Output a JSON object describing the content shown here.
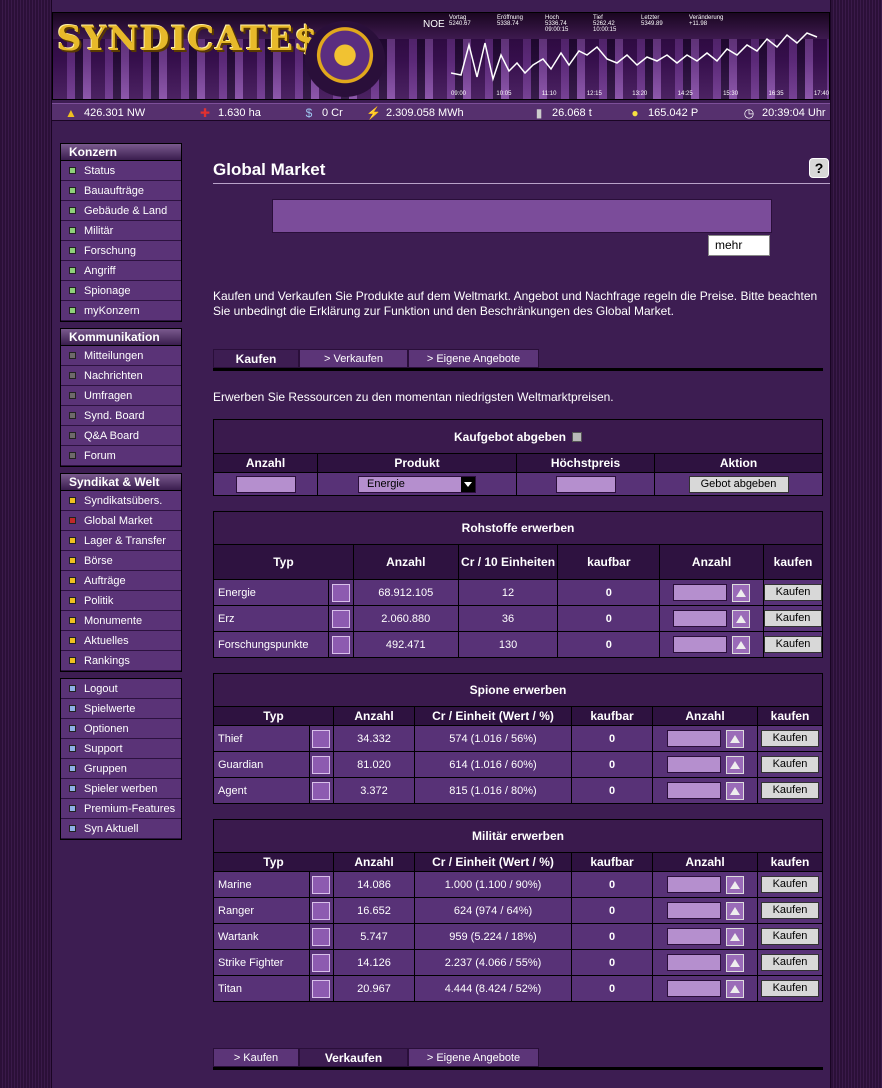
{
  "banner": {
    "logo": "SYNDICATE$",
    "noe": "NOE",
    "ticker": {
      "headers": [
        "Vortag",
        "Eröffnung",
        "Hoch",
        "Tief",
        "Letzter",
        "Veränderung"
      ],
      "row1": [
        "5240.67",
        "5338.74",
        "5336.74",
        "5262.42",
        "5349.89",
        "+11.98"
      ],
      "row2": [
        "",
        "",
        "09:00:15",
        "10:00:15",
        "",
        ""
      ]
    },
    "times": [
      "09:00",
      "10:05",
      "11:10",
      "12:15",
      "13:20",
      "14:25",
      "15:30",
      "16:35",
      "17:40"
    ]
  },
  "status": {
    "nw": "426.301 NW",
    "land": "1.630 ha",
    "credits": "0 Cr",
    "energy": "2.309.058 MWh",
    "ore": "26.068 t",
    "research": "165.042 P",
    "time": "20:39:04 Uhr"
  },
  "nav": {
    "konzern": {
      "title": "Konzern",
      "items": [
        "Status",
        "Bauaufträge",
        "Gebäude & Land",
        "Militär",
        "Forschung",
        "Angriff",
        "Spionage",
        "myKonzern"
      ]
    },
    "kommunikation": {
      "title": "Kommunikation",
      "items": [
        "Mitteilungen",
        "Nachrichten",
        "Umfragen",
        "Synd. Board",
        "Q&A Board",
        "Forum"
      ]
    },
    "syndikat": {
      "title": "Syndikat & Welt",
      "items": [
        "Syndikatsübers.",
        "Global Market",
        "Lager & Transfer",
        "Börse",
        "Aufträge",
        "Politik",
        "Monumente",
        "Aktuelles",
        "Rankings"
      ]
    },
    "misc": {
      "items": [
        "Logout",
        "Spielwerte",
        "Optionen",
        "Support",
        "Gruppen",
        "Spieler werben",
        "Premium-Features",
        "Syn Aktuell"
      ]
    }
  },
  "colors": {
    "konzern": "#8fd07a",
    "kommunikation": "#6e6a6a",
    "syndikat": "#f0c020",
    "syndikat_active": "#c22a2a",
    "misc": "#8fb0e6"
  },
  "page": {
    "title": "Global Market",
    "help": "?",
    "mehr": "mehr",
    "description": "Kaufen und Verkaufen Sie Produkte auf dem Weltmarkt. Angebot und Nachfrage regeln die Preise. Bitte beachten Sie unbedingt die Erklärung zur Funktion und den Beschränkungen des Global Market.",
    "tabs_top": [
      "Kaufen",
      "> Verkaufen",
      "> Eigene Angebote"
    ],
    "tabs_bottom": [
      "> Kaufen",
      "Verkaufen",
      "> Eigene Angebote"
    ],
    "intro": "Erwerben Sie Ressourcen zu den momentan niedrigsten Weltmarktpreisen."
  },
  "bid": {
    "caption": "Kaufgebot abgeben",
    "headers": [
      "Anzahl",
      "Produkt",
      "Höchstpreis",
      "Aktion"
    ],
    "product": "Energie",
    "button": "Gebot abgeben"
  },
  "resources": {
    "caption": "Rohstoffe erwerben",
    "headers": [
      "Typ",
      "Anzahl",
      "Cr / 10 Einheiten",
      "kaufbar",
      "Anzahl",
      "kaufen"
    ],
    "rows": [
      {
        "typ": "Energie",
        "anzahl": "68.912.105",
        "preis": "12",
        "kaufbar": "0"
      },
      {
        "typ": "Erz",
        "anzahl": "2.060.880",
        "preis": "36",
        "kaufbar": "0"
      },
      {
        "typ": "Forschungspunkte",
        "anzahl": "492.471",
        "preis": "130",
        "kaufbar": "0"
      }
    ]
  },
  "spies": {
    "caption": "Spione erwerben",
    "headers": [
      "Typ",
      "Anzahl",
      "Cr / Einheit (Wert / %)",
      "kaufbar",
      "Anzahl",
      "kaufen"
    ],
    "rows": [
      {
        "typ": "Thief",
        "anzahl": "34.332",
        "preis": "574 (1.016 / 56%)",
        "kaufbar": "0"
      },
      {
        "typ": "Guardian",
        "anzahl": "81.020",
        "preis": "614 (1.016 / 60%)",
        "kaufbar": "0"
      },
      {
        "typ": "Agent",
        "anzahl": "3.372",
        "preis": "815 (1.016 / 80%)",
        "kaufbar": "0"
      }
    ]
  },
  "military": {
    "caption": "Militär erwerben",
    "headers": [
      "Typ",
      "Anzahl",
      "Cr / Einheit (Wert / %)",
      "kaufbar",
      "Anzahl",
      "kaufen"
    ],
    "rows": [
      {
        "typ": "Marine",
        "anzahl": "14.086",
        "preis": "1.000 (1.100 / 90%)",
        "kaufbar": "0"
      },
      {
        "typ": "Ranger",
        "anzahl": "16.652",
        "preis": "624 (974 / 64%)",
        "kaufbar": "0"
      },
      {
        "typ": "Wartank",
        "anzahl": "5.747",
        "preis": "959 (5.224 / 18%)",
        "kaufbar": "0"
      },
      {
        "typ": "Strike Fighter",
        "anzahl": "14.126",
        "preis": "2.237 (4.066 / 55%)",
        "kaufbar": "0"
      },
      {
        "typ": "Titan",
        "anzahl": "20.967",
        "preis": "4.444 (8.424 / 52%)",
        "kaufbar": "0"
      }
    ]
  },
  "buy_label": "Kaufen"
}
